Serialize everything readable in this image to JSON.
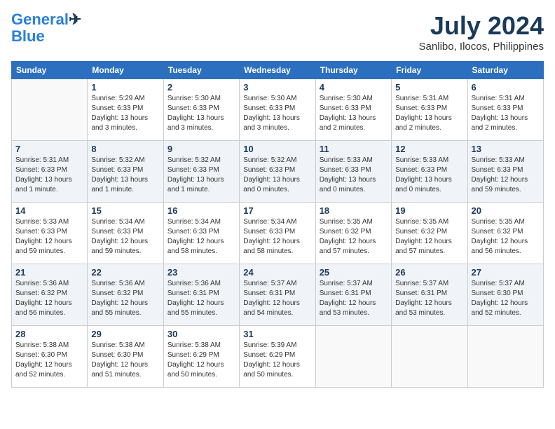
{
  "header": {
    "logo_line1": "General",
    "logo_line2": "Blue",
    "month_year": "July 2024",
    "location": "Sanlibo, Ilocos, Philippines"
  },
  "days_of_week": [
    "Sunday",
    "Monday",
    "Tuesday",
    "Wednesday",
    "Thursday",
    "Friday",
    "Saturday"
  ],
  "weeks": [
    [
      {
        "day": "",
        "info": ""
      },
      {
        "day": "1",
        "info": "Sunrise: 5:29 AM\nSunset: 6:33 PM\nDaylight: 13 hours\nand 3 minutes."
      },
      {
        "day": "2",
        "info": "Sunrise: 5:30 AM\nSunset: 6:33 PM\nDaylight: 13 hours\nand 3 minutes."
      },
      {
        "day": "3",
        "info": "Sunrise: 5:30 AM\nSunset: 6:33 PM\nDaylight: 13 hours\nand 3 minutes."
      },
      {
        "day": "4",
        "info": "Sunrise: 5:30 AM\nSunset: 6:33 PM\nDaylight: 13 hours\nand 2 minutes."
      },
      {
        "day": "5",
        "info": "Sunrise: 5:31 AM\nSunset: 6:33 PM\nDaylight: 13 hours\nand 2 minutes."
      },
      {
        "day": "6",
        "info": "Sunrise: 5:31 AM\nSunset: 6:33 PM\nDaylight: 13 hours\nand 2 minutes."
      }
    ],
    [
      {
        "day": "7",
        "info": "Sunrise: 5:31 AM\nSunset: 6:33 PM\nDaylight: 13 hours\nand 1 minute."
      },
      {
        "day": "8",
        "info": "Sunrise: 5:32 AM\nSunset: 6:33 PM\nDaylight: 13 hours\nand 1 minute."
      },
      {
        "day": "9",
        "info": "Sunrise: 5:32 AM\nSunset: 6:33 PM\nDaylight: 13 hours\nand 1 minute."
      },
      {
        "day": "10",
        "info": "Sunrise: 5:32 AM\nSunset: 6:33 PM\nDaylight: 13 hours\nand 0 minutes."
      },
      {
        "day": "11",
        "info": "Sunrise: 5:33 AM\nSunset: 6:33 PM\nDaylight: 13 hours\nand 0 minutes."
      },
      {
        "day": "12",
        "info": "Sunrise: 5:33 AM\nSunset: 6:33 PM\nDaylight: 13 hours\nand 0 minutes."
      },
      {
        "day": "13",
        "info": "Sunrise: 5:33 AM\nSunset: 6:33 PM\nDaylight: 12 hours\nand 59 minutes."
      }
    ],
    [
      {
        "day": "14",
        "info": "Sunrise: 5:33 AM\nSunset: 6:33 PM\nDaylight: 12 hours\nand 59 minutes."
      },
      {
        "day": "15",
        "info": "Sunrise: 5:34 AM\nSunset: 6:33 PM\nDaylight: 12 hours\nand 59 minutes."
      },
      {
        "day": "16",
        "info": "Sunrise: 5:34 AM\nSunset: 6:33 PM\nDaylight: 12 hours\nand 58 minutes."
      },
      {
        "day": "17",
        "info": "Sunrise: 5:34 AM\nSunset: 6:33 PM\nDaylight: 12 hours\nand 58 minutes."
      },
      {
        "day": "18",
        "info": "Sunrise: 5:35 AM\nSunset: 6:32 PM\nDaylight: 12 hours\nand 57 minutes."
      },
      {
        "day": "19",
        "info": "Sunrise: 5:35 AM\nSunset: 6:32 PM\nDaylight: 12 hours\nand 57 minutes."
      },
      {
        "day": "20",
        "info": "Sunrise: 5:35 AM\nSunset: 6:32 PM\nDaylight: 12 hours\nand 56 minutes."
      }
    ],
    [
      {
        "day": "21",
        "info": "Sunrise: 5:36 AM\nSunset: 6:32 PM\nDaylight: 12 hours\nand 56 minutes."
      },
      {
        "day": "22",
        "info": "Sunrise: 5:36 AM\nSunset: 6:32 PM\nDaylight: 12 hours\nand 55 minutes."
      },
      {
        "day": "23",
        "info": "Sunrise: 5:36 AM\nSunset: 6:31 PM\nDaylight: 12 hours\nand 55 minutes."
      },
      {
        "day": "24",
        "info": "Sunrise: 5:37 AM\nSunset: 6:31 PM\nDaylight: 12 hours\nand 54 minutes."
      },
      {
        "day": "25",
        "info": "Sunrise: 5:37 AM\nSunset: 6:31 PM\nDaylight: 12 hours\nand 53 minutes."
      },
      {
        "day": "26",
        "info": "Sunrise: 5:37 AM\nSunset: 6:31 PM\nDaylight: 12 hours\nand 53 minutes."
      },
      {
        "day": "27",
        "info": "Sunrise: 5:37 AM\nSunset: 6:30 PM\nDaylight: 12 hours\nand 52 minutes."
      }
    ],
    [
      {
        "day": "28",
        "info": "Sunrise: 5:38 AM\nSunset: 6:30 PM\nDaylight: 12 hours\nand 52 minutes."
      },
      {
        "day": "29",
        "info": "Sunrise: 5:38 AM\nSunset: 6:30 PM\nDaylight: 12 hours\nand 51 minutes."
      },
      {
        "day": "30",
        "info": "Sunrise: 5:38 AM\nSunset: 6:29 PM\nDaylight: 12 hours\nand 50 minutes."
      },
      {
        "day": "31",
        "info": "Sunrise: 5:39 AM\nSunset: 6:29 PM\nDaylight: 12 hours\nand 50 minutes."
      },
      {
        "day": "",
        "info": ""
      },
      {
        "day": "",
        "info": ""
      },
      {
        "day": "",
        "info": ""
      }
    ]
  ]
}
